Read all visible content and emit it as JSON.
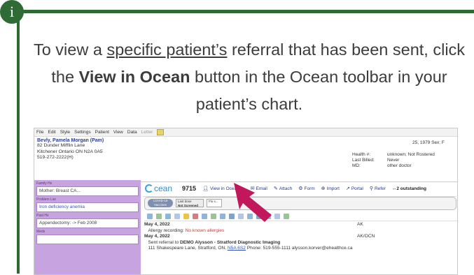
{
  "callout": {
    "icon_letter": "i",
    "text_before": "To view a ",
    "text_underlined": "specific patient’s",
    "text_mid": " referral that has been sent, click the ",
    "text_bold": "View in Ocean",
    "text_after": " button in the Ocean toolbar in your patient’s chart."
  },
  "emr": {
    "menu": [
      "File",
      "Edit",
      "Style",
      "Settings",
      "Patient",
      "View",
      "Data",
      "Letter"
    ],
    "patient": {
      "name": "Bevly, Pamela Morgan (Pam)",
      "address1": "82 Dunder Mifflin Lane",
      "address2": "Kitchener Ontario ON   N2A 0A5",
      "phone": "519-272-2222(H)",
      "dob": "25, 1979   Sex: F",
      "health_label": "Health #:",
      "health_value": "unknown;   Not Rostered",
      "billed_label": "Last Billed:",
      "billed_value": "Never",
      "md_label": "MD:",
      "md_value": "other doctor"
    },
    "left": {
      "family_hx_label": "Family Hx",
      "family_hx_value": "Mother: Breast CA...",
      "problem_label": "Problem List",
      "problem_value": "Iron deficiency anemia",
      "past_hx_label": "Past Hx",
      "past_hx_value": "Appendectomy: -> Feb 2008",
      "meds_label": "Meds"
    },
    "ocean": {
      "logo": "cean",
      "count": "9715",
      "view": "View in Ocean",
      "email": "Email",
      "attach": "Attach",
      "form": "Form",
      "import": "Import",
      "portal": "Portal",
      "refer": "Refer",
      "outstanding": "↔2 outstanding"
    },
    "status": {
      "covid": "COVID-19 Vaccines",
      "last_dose": "Last dose",
      "not_screened": "Not Screened",
      "flu": "Flu s..."
    },
    "notes": [
      {
        "date": "May 4, 2022",
        "author": "AK",
        "line": "Allergy recording: ",
        "allergy": "No known allergies"
      },
      {
        "date": "May 4, 2022",
        "author": "AK/OCN",
        "line": "Sent referral to ",
        "recipient": "DEMO Alysson - Stratford Diagnostic Imaging",
        "address": "111 Shakespeare Lane, Stratford, ON, ",
        "postal": "N5A 6S2",
        "phone": "  Phone: 519-555-1111  alysson.korver@ehealthce.ca"
      }
    ]
  },
  "colors": {
    "accent_green": "#2e6b34",
    "ocean_blue": "#2c8fd1",
    "arrow": "#c2185b",
    "sidebar": "#c7a4e0"
  }
}
